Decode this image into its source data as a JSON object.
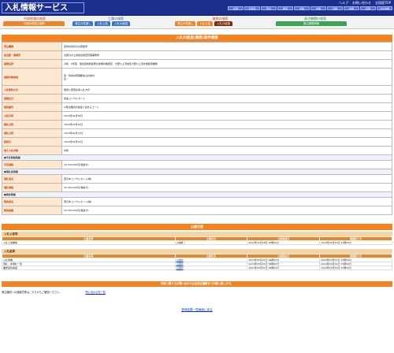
{
  "header": {
    "logo": "入札情報サービス",
    "links": [
      "ヘルプ",
      "お問い合わせ",
      "全国版TOP"
    ],
    "regions": [
      "全国",
      "北海道",
      "東北",
      "関東",
      "北陸",
      "中部",
      "近畿",
      "中国",
      "四国",
      "九州沖縄"
    ]
  },
  "nav": {
    "groups": [
      {
        "title": "工事の検索",
        "tabs": [
          "発注の見通し",
          "入札公告",
          "入札の経過"
        ],
        "color": "#3a74c9"
      },
      {
        "title": "業務の検索",
        "tabs": [
          "発注の見通し",
          "入札公告",
          "入札の経過"
        ],
        "color": "#f58220"
      },
      {
        "title": "発注機関の検索",
        "tabs": [
          "発注機関情報"
        ],
        "color": "#3aa655"
      }
    ],
    "left_label": "中部地域の検索",
    "left_tab": "中部地域発注機関"
  },
  "section_title": "入札の経過(業務)案件概要",
  "detail": [
    {
      "label": "発注機関",
      "value": "農林水産省九州農政局"
    },
    {
      "label": "担当部・事務所",
      "value": "北部九州土地改良調査管理事務所"
    },
    {
      "label": "業務名称",
      "value": "令和　5年度　国営造成施設緊急整備対策調査　大野川上流地区大野川上流水量観測業務"
    },
    {
      "label": "業務対象地域",
      "value": "熊・熊本県阿蘇郡産山村地内\n宮・",
      "tall": true
    },
    {
      "label": "入札契約方式",
      "value": "簡易公募型競争入札方式"
    },
    {
      "label": "業務区分",
      "value": "建設コンサルタント"
    },
    {
      "label": "契約番号",
      "value": "※発注機関が独自に定めるコード"
    },
    {
      "label": "公告日時",
      "value": "2023年02月28日"
    },
    {
      "label": "開札日時",
      "value": "2023年03月15日"
    },
    {
      "label": "落札日時",
      "value": "2023年04月13日"
    },
    {
      "label": "契約日",
      "value": "2023年04月21日"
    },
    {
      "label": "電子入札対象",
      "value": "対象"
    },
    {
      "sub": "■予定価格情報"
    },
    {
      "label": "予定価格",
      "value": "20,700,000円(税抜き)"
    },
    {
      "sub": "■落札者情報"
    },
    {
      "label": "落札者名",
      "value": "西日本コンサルタント(株)"
    },
    {
      "label": "落札価格",
      "value": "20,300,000円(税抜き)"
    },
    {
      "sub": "■契約情報"
    },
    {
      "label": "契約者名",
      "value": "西日本コンサルタント(株)"
    },
    {
      "label": "契約金額",
      "value": "20,300,000円(税抜き)"
    }
  ],
  "public": {
    "title": "公開文書",
    "sections": [
      {
        "name": "入札公告等",
        "headers": [
          "文書名称",
          "公開状況",
          "公開開始日",
          "閲覧終了日"
        ],
        "rows": [
          [
            "入札公告書等",
            "公開終了",
            "2023年02月28日 00時00分",
            "2023年03月10日 23時59分"
          ]
        ]
      },
      {
        "name": "入札結果",
        "headers": [
          "文書名称",
          "公開状況",
          "公開開始日",
          "閲覧終了日"
        ],
        "rows": [
          [
            "入札調書",
            "公開中",
            "2023年05月01日 09時00分",
            "2024年03月31日 23時59分"
          ],
          [
            "落札・非落札一覧",
            "公開中",
            "2023年05月01日 09時00分",
            "2024年03月31日 23時59分"
          ],
          [
            "業務契約締結",
            "公開中",
            "2023年05月01日 09時00分",
            "2024年03月31日 23時59分"
          ]
        ]
      }
    ]
  },
  "bottom_bar": "内容に関するお問い合わせは各発注機関までお願い致します。",
  "contact": {
    "text": "発注機関への連絡先等はこちらからご確認ください。",
    "link": "問い合わせ先一覧"
  },
  "back_link": "検索結果一覧画面に戻る"
}
